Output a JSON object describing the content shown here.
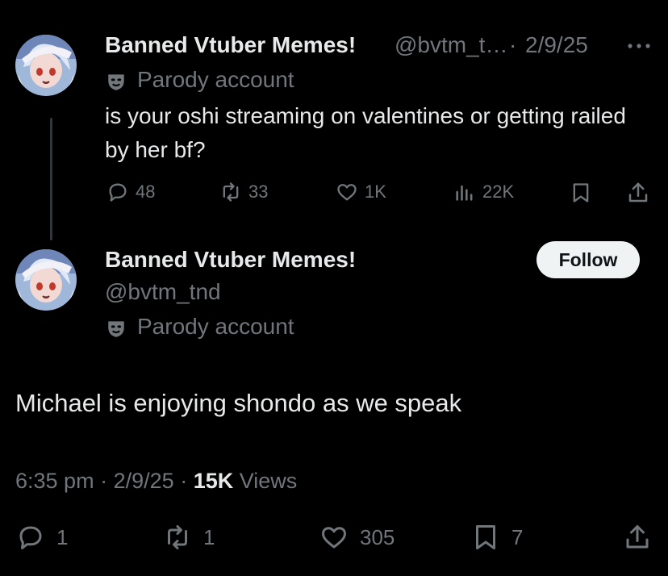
{
  "colors": {
    "background": "#000000",
    "text": "#e7e9ea",
    "muted": "#71767b",
    "follow_bg": "#eff3f4"
  },
  "parent_tweet": {
    "display_name": "Banned Vtuber Memes!",
    "handle": "@bvtm_t…",
    "separator": "·",
    "date": "2/9/25",
    "more_icon": "more-dots-icon",
    "label_icon": "parody-mask-icon",
    "label": "Parody account",
    "text": "is your oshi streaming on valentines or getting railed by her bf?",
    "actions": {
      "replies": "48",
      "reposts": "33",
      "likes": "1K",
      "views": "22K"
    }
  },
  "main_tweet": {
    "display_name": "Banned Vtuber Memes!",
    "handle": "@bvtm_tnd",
    "follow_label": "Follow",
    "label_icon": "parody-mask-icon",
    "label": "Parody account",
    "text": "Michael is enjoying shondo as we speak",
    "time": "6:35 pm",
    "sep1": "·",
    "date": "2/9/25",
    "sep2": "·",
    "views_count": "15K",
    "views_label": "Views",
    "actions": {
      "replies": "1",
      "reposts": "1",
      "likes": "305",
      "bookmarks": "7"
    }
  }
}
